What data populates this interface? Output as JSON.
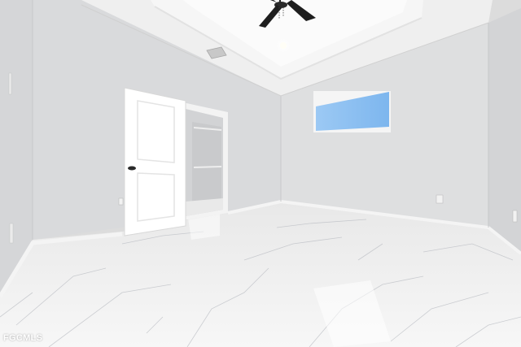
{
  "photo": {
    "subject": "empty-bedroom-interior",
    "colors": {
      "wall": "#dcdcdc",
      "floor": "#f1f1f1",
      "ceiling": "#f4f4f4",
      "sky_window": "#8cc0f0",
      "fan_blade": "#1e1e1e"
    }
  },
  "watermark": {
    "text": "FGCMLS"
  }
}
